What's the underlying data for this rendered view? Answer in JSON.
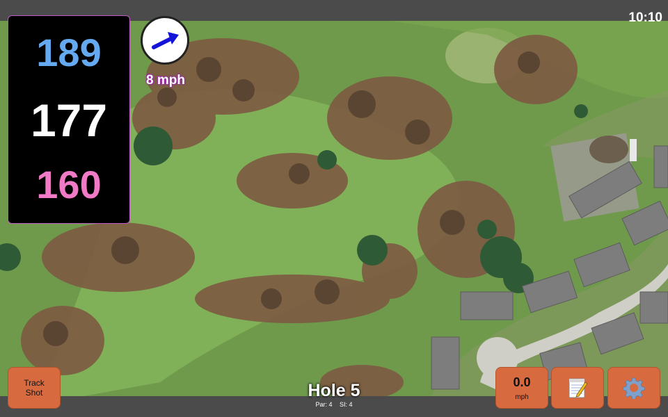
{
  "status_bar": {
    "time": "10:10"
  },
  "distances": {
    "back": "189",
    "middle": "177",
    "front": "160",
    "colors": {
      "back": "#65a9f0",
      "middle": "#ffffff",
      "front": "#f07ac6"
    }
  },
  "wind": {
    "speed_label": "8 mph",
    "arrow_icon": "wind-direction-arrow",
    "arrow_color": "#1414d8"
  },
  "hole": {
    "title": "Hole 5",
    "par_label": "Par: 4",
    "si_label": "SI: 4"
  },
  "buttons": {
    "track_shot_line1": "Track",
    "track_shot_line2": "Shot",
    "speed_value": "0.0",
    "speed_unit": "mph",
    "notes_icon": "notepad-icon",
    "settings_icon": "gear-icon",
    "accent": "#d86a40"
  },
  "map": {
    "base_color": "#6f9a4c"
  }
}
